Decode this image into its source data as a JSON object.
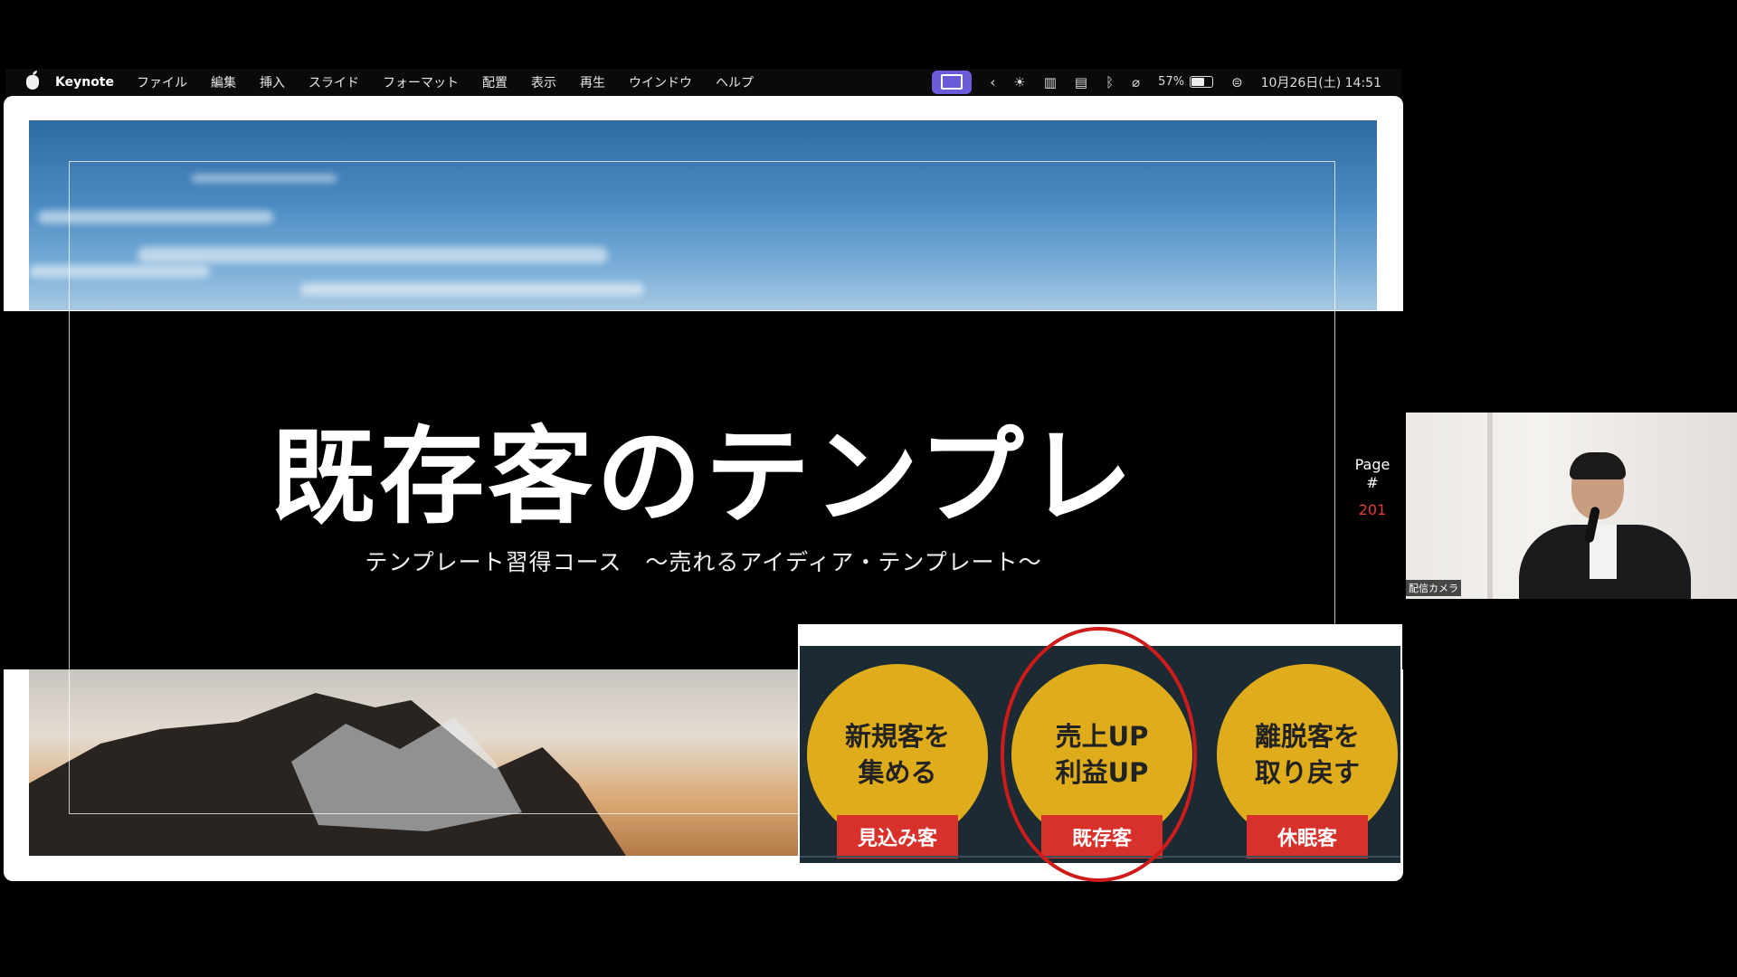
{
  "menubar": {
    "app_name": "Keynote",
    "items": [
      "ファイル",
      "編集",
      "挿入",
      "スライド",
      "フォーマット",
      "配置",
      "表示",
      "再生",
      "ウインドウ",
      "ヘルプ"
    ],
    "battery_percent": "57%",
    "battery_level": 0.57,
    "datetime": "10月26日(土) 14:51"
  },
  "slide": {
    "title": "既存客のテンプレ",
    "subtitle": "テンプレート習得コース　〜売れるアイディア・テンプレート〜",
    "page_label": "Page\n#",
    "page_number": "201"
  },
  "overlay": {
    "circles": [
      {
        "text": "新規客を\n集める",
        "tag": "見込み客"
      },
      {
        "text": "売上UP\n利益UP",
        "tag": "既存客"
      },
      {
        "text": "離脱客を\n取り戻す",
        "tag": "休眠客"
      }
    ],
    "highlighted": "既存客"
  },
  "camera": {
    "label": "配信カメラ"
  },
  "colors": {
    "circle_fill": "#dfad1c",
    "tag_red": "#d8302b",
    "highlight_ring": "#d01b1b",
    "page_number": "#e23b3b",
    "share_button": "#6a5bd8"
  }
}
